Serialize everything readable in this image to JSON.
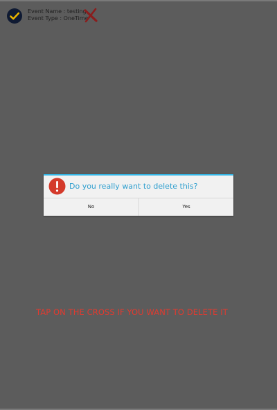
{
  "event": {
    "name_line": "Event Name : testing",
    "type_line": "Event Type : OneTime"
  },
  "dialog": {
    "title": "Do you really want to delete this?",
    "no_label": "No",
    "yes_label": "Yes"
  },
  "hint": {
    "text": "TAP ON THE CROSS IF YOU WANT TO DELETE IT"
  },
  "colors": {
    "overlay": "#5c5c5c",
    "dialog_accent": "#33b5e5",
    "dialog_title": "#2f9fcf",
    "alert_red": "#d43a2b",
    "hint_red": "#e23a2f",
    "check_bg": "#0f1a33",
    "check_mark": "#e8b400",
    "cross_red": "#8a1d1d"
  },
  "icons": {
    "event_status": "check-circle-icon",
    "delete": "cross-icon",
    "dialog_alert": "alert-icon"
  }
}
